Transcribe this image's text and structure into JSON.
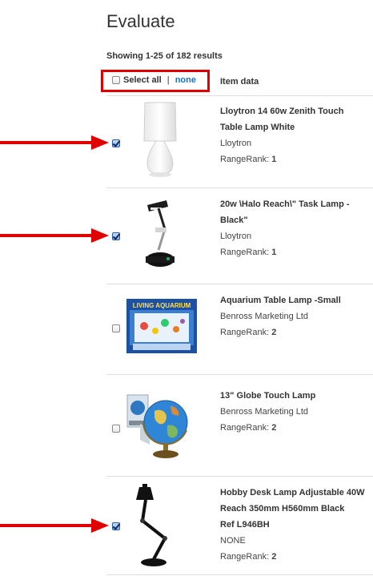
{
  "page": {
    "title": "Evaluate",
    "showing": "Showing 1-25 of 182 results",
    "select_all_label": "Select all",
    "separator": " | ",
    "none_label": "none",
    "column_header": "Item data",
    "rangerank_label": "RangeRank: "
  },
  "items": [
    {
      "name_line1": "Lloytron 14 60w Zenith Touch",
      "name_line2": "Table Lamp White",
      "brand": "Lloytron",
      "rank": "1",
      "checked": true
    },
    {
      "name_line1": "20w \\Halo Reach\\\" Task Lamp -",
      "name_line2": "Black\"",
      "brand": "Lloytron",
      "rank": "1",
      "checked": true
    },
    {
      "name_line1": "Aquarium Table Lamp -Small",
      "brand": "Benross Marketing Ltd",
      "rank": "2",
      "checked": false
    },
    {
      "name_line1": "13\" Globe Touch Lamp",
      "brand": "Benross Marketing Ltd",
      "rank": "2",
      "checked": false
    },
    {
      "name_line1": "Hobby Desk Lamp Adjustable 40W",
      "name_line2": "Reach 350mm H560mm Black",
      "name_line3": "Ref L946BH",
      "brand": "NONE",
      "rank": "2",
      "checked": true
    }
  ],
  "thumbnails": {
    "aquarium_text": "LIVING AQUARIUM"
  },
  "colors": {
    "annotation_red": "#e00000",
    "link_blue": "#1a73c7"
  }
}
